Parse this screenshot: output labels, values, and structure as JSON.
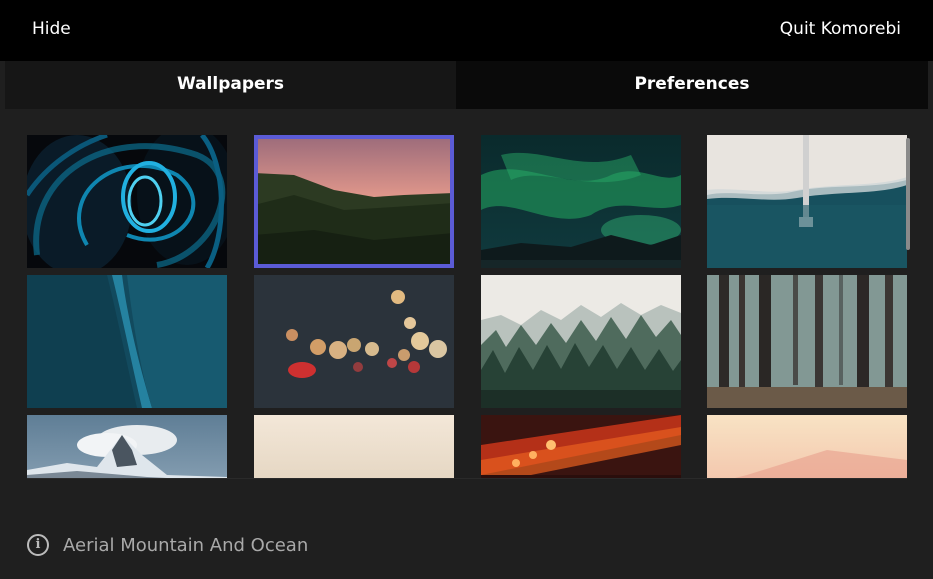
{
  "topbar": {
    "hide_label": "Hide",
    "quit_label": "Quit Komorebi"
  },
  "tabs": [
    {
      "label": "Wallpapers",
      "active": true
    },
    {
      "label": "Preferences",
      "active": false
    }
  ],
  "wallpapers": [
    {
      "id": "light-trail-spiral",
      "selected": false
    },
    {
      "id": "pink-sunset-hills",
      "selected": true
    },
    {
      "id": "northern-lights",
      "selected": false
    },
    {
      "id": "aerial-pier-beach",
      "selected": false
    },
    {
      "id": "blue-water-texture",
      "selected": false
    },
    {
      "id": "city-bokeh-lights",
      "selected": false
    },
    {
      "id": "misty-pine-forest",
      "selected": false
    },
    {
      "id": "dark-foggy-forest",
      "selected": false
    },
    {
      "id": "snowy-mountain-peak",
      "selected": false
    },
    {
      "id": "beige-gradient",
      "selected": false
    },
    {
      "id": "orange-train-lights",
      "selected": false
    },
    {
      "id": "peach-mountain-haze",
      "selected": false
    }
  ],
  "footer": {
    "icon": "info-icon",
    "text": "Aerial Mountain And Ocean"
  },
  "colors": {
    "selection_border": "#5b5bd6",
    "background": "#1f1f1f",
    "topbar": "#000000"
  }
}
